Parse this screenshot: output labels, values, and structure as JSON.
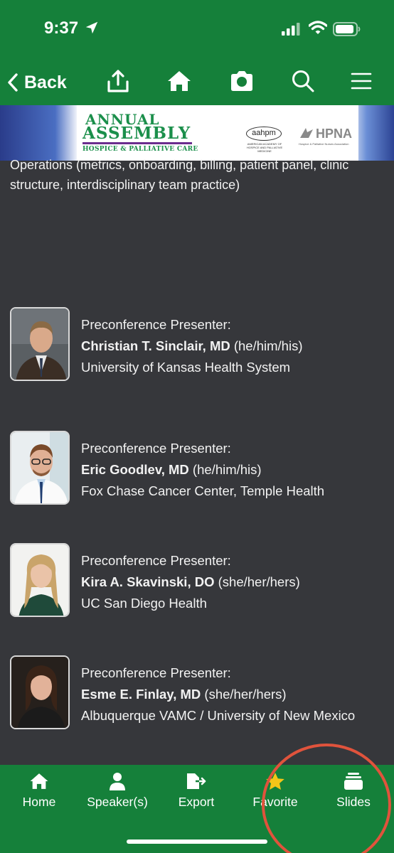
{
  "status_bar": {
    "time": "9:37"
  },
  "nav": {
    "back_label": "Back"
  },
  "banner": {
    "line1": "ANNUAL",
    "line2": "ASSEMBLY",
    "subtitle": "HOSPICE & PALLIATIVE CARE",
    "aahpm": "aahpm",
    "aahpm_sub": "AMERICAN ACADEMY OF HOSPICE AND PALLIATIVE MEDICINE",
    "hpna": "HPNA",
    "hpna_sub": "Hospice & Palliative Nurses Association"
  },
  "topic_text": "Operations (metrics, onboarding, billing, patient panel, clinic structure, interdisciplinary team practice)",
  "presenters": [
    {
      "role": "Preconference Presenter:",
      "name": "Christian T. Sinclair, MD",
      "pronouns": " (he/him/his)",
      "affiliation": "University of Kansas Health System"
    },
    {
      "role": "Preconference Presenter:",
      "name": "Eric Goodlev, MD",
      "pronouns": " (he/him/his)",
      "affiliation": "Fox Chase Cancer Center, Temple Health"
    },
    {
      "role": "Preconference Presenter:",
      "name": "Kira A. Skavinski, DO",
      "pronouns": " (she/her/hers)",
      "affiliation": "UC San Diego Health"
    },
    {
      "role": "Preconference Presenter:",
      "name": "Esme E. Finlay, MD",
      "pronouns": " (she/her/hers)",
      "affiliation": "Albuquerque VAMC / University of New Mexico"
    }
  ],
  "tabs": [
    {
      "label": "Home",
      "icon": "home-icon"
    },
    {
      "label": "Speaker(s)",
      "icon": "person-icon"
    },
    {
      "label": "Export",
      "icon": "export-icon"
    },
    {
      "label": "Favorite",
      "icon": "star-icon"
    },
    {
      "label": "Slides",
      "icon": "slides-icon"
    }
  ],
  "colors": {
    "header": "#15803a",
    "background": "#36373b",
    "favorite_star": "#f5c518",
    "annotation": "#e0533c"
  }
}
